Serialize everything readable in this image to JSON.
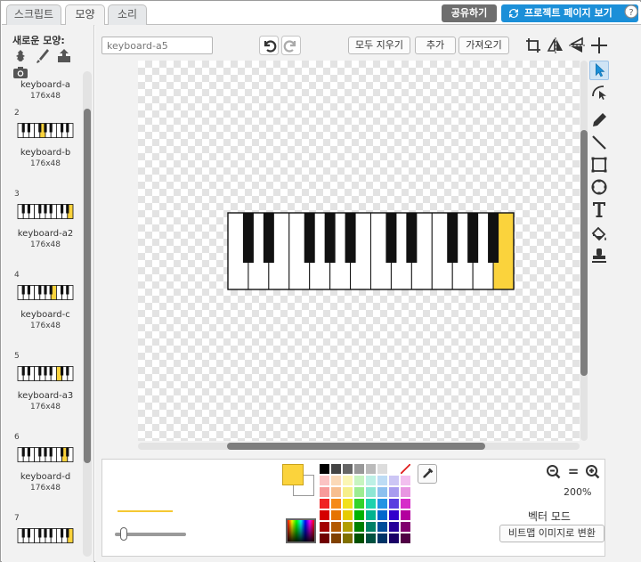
{
  "tabs": [
    {
      "label": "스크립트",
      "active": false
    },
    {
      "label": "모양",
      "active": true
    },
    {
      "label": "소리",
      "active": false
    }
  ],
  "header": {
    "share_label": "공유하기",
    "project_page_label": "프로젝트 페이지 보기",
    "help_symbol": "?"
  },
  "left": {
    "new_costume_label": "새로운 모양:",
    "new_costume_icons": [
      "sprite-library-icon",
      "paint-brush-icon",
      "upload-icon",
      "camera-icon"
    ],
    "items": [
      {
        "number": "",
        "name": "keyboard-a",
        "size": "176x48",
        "highlight": -1
      },
      {
        "number": "2",
        "name": "keyboard-b",
        "size": "176x48",
        "highlight": 4
      },
      {
        "number": "3",
        "name": "keyboard-a2",
        "size": "176x48",
        "highlight": 9
      },
      {
        "number": "4",
        "name": "keyboard-c",
        "size": "176x48",
        "highlight": 6
      },
      {
        "number": "5",
        "name": "keyboard-a3",
        "size": "176x48",
        "highlight": 7
      },
      {
        "number": "6",
        "name": "keyboard-d",
        "size": "176x48",
        "highlight": 8
      },
      {
        "number": "7",
        "name": "",
        "size": "",
        "highlight": 9
      }
    ]
  },
  "editor": {
    "costume_name": "keyboard-a5",
    "clear_label": "모두 지우기",
    "add_label": "추가",
    "import_label": "가져오기",
    "canvas_highlight_key": 13,
    "white_keys": 14,
    "black_keys_after": [
      0,
      1,
      3,
      4,
      5,
      7,
      8,
      10,
      11,
      12
    ]
  },
  "bottom": {
    "zoom_level": "200%",
    "zoom_equals": "=",
    "mode_label": "벡터 모드",
    "convert_label": "비트맵 이미지로 변환",
    "fill_color": "#fbd33c",
    "stroke_preview_color": "#f5c832",
    "palette": [
      [
        "#000000",
        "#444444",
        "#666666",
        "#999999",
        "#bbbbbb",
        "#dddddd",
        "#ffffff",
        "none"
      ],
      [
        "#fbc3c3",
        "#fbd9b7",
        "#fbf6b4",
        "#c7f5c0",
        "#bdf0e6",
        "#bddcf5",
        "#ccc6f5",
        "#f2bfef"
      ],
      [
        "#f79a9a",
        "#f7be8f",
        "#f6ef89",
        "#9ced91",
        "#8de6d4",
        "#8cc0ef",
        "#a89cef",
        "#e895e2"
      ],
      [
        "#f02222",
        "#f58a18",
        "#f1e11c",
        "#34d32b",
        "#1ed2ad",
        "#2394e3",
        "#5a3ee0",
        "#d62dc9"
      ],
      [
        "#d50000",
        "#e67300",
        "#e6cc00",
        "#00b300",
        "#00b38f",
        "#0066cc",
        "#3300cc",
        "#b3009e"
      ],
      [
        "#a30000",
        "#b35900",
        "#b39e00",
        "#008000",
        "#008066",
        "#004c99",
        "#260099",
        "#80006e"
      ],
      [
        "#700000",
        "#804000",
        "#807000",
        "#005000",
        "#005040",
        "#003366",
        "#1a0066",
        "#500045"
      ]
    ]
  }
}
